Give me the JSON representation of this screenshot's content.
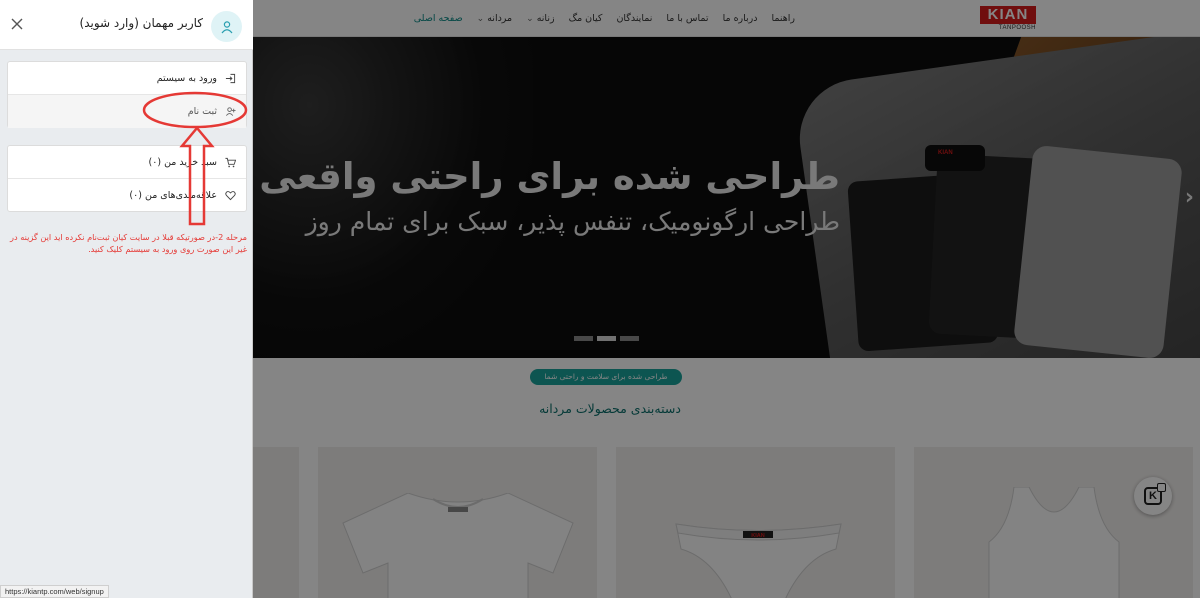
{
  "nav": {
    "logo_text": "KIAN",
    "logo_sub": "TANPOOSH",
    "links": [
      {
        "label": "صفحه اصلی",
        "active": true,
        "dropdown": false
      },
      {
        "label": "مردانه",
        "active": false,
        "dropdown": true
      },
      {
        "label": "زنانه",
        "active": false,
        "dropdown": true
      },
      {
        "label": "کیان مگ",
        "active": false,
        "dropdown": false
      },
      {
        "label": "نمایندگان",
        "active": false,
        "dropdown": false
      },
      {
        "label": "تماس با ما",
        "active": false,
        "dropdown": false
      },
      {
        "label": "درباره ما",
        "active": false,
        "dropdown": false
      },
      {
        "label": "راهنما",
        "active": false,
        "dropdown": false
      }
    ]
  },
  "hero": {
    "title": "طراحی شده برای راحتی واقعی",
    "subtitle": "طراحی ارگونومیک، تنفس پذیر، سبک برای تمام روز",
    "slide_count": 3,
    "active_slide": 2
  },
  "section": {
    "badge": "طراحی شده برای سلامت و راحتی شما",
    "title": "دسته‌بندی محصولات مردانه"
  },
  "drawer": {
    "user_name": "کاربر مهمان (وارد شوید)",
    "items_group_1": [
      {
        "label": "ورود به سیستم",
        "icon": "login-icon"
      },
      {
        "label": "ثبت نام",
        "icon": "add-user-icon"
      }
    ],
    "items_group_2": [
      {
        "label": "سبد خرید من (۰)",
        "icon": "cart-icon"
      },
      {
        "label": "علاقه‌مندی‌های من (۰)",
        "icon": "heart-icon"
      }
    ],
    "instruction": "مرحله 2-در صورتیکه قبلا در سایت کیان ثبت‌نام نکرده اید این گزینه در غیر این صورت روی ورود به سیستم کلیک کنید."
  },
  "status_url": "https://kiantp.com/web/signup",
  "colors": {
    "accent": "#0a8a86",
    "brand_red": "#d71c1c",
    "annotation_red": "#e53935"
  }
}
